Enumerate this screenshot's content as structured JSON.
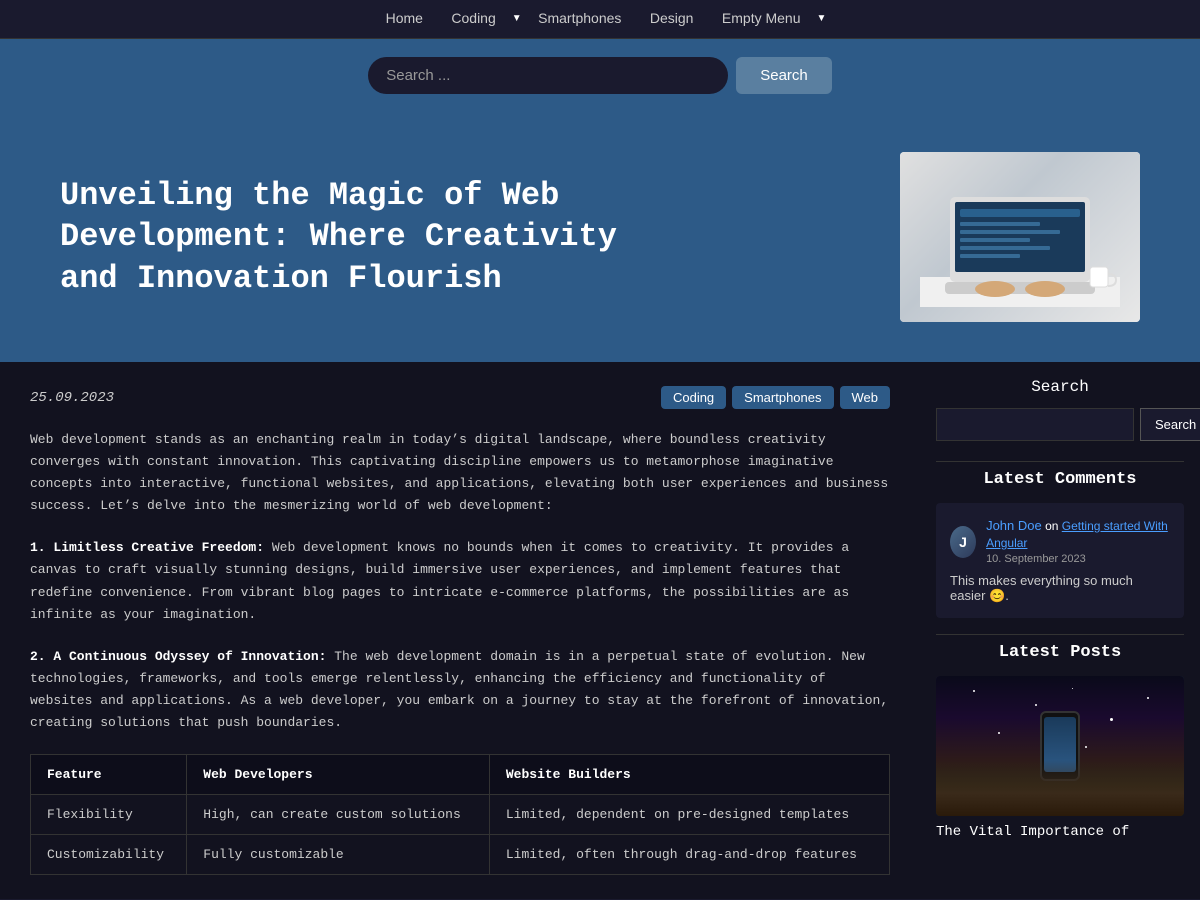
{
  "nav": {
    "items": [
      {
        "label": "Home",
        "href": "#",
        "dropdown": false
      },
      {
        "label": "Coding",
        "href": "#",
        "dropdown": true
      },
      {
        "label": "Smartphones",
        "href": "#",
        "dropdown": false
      },
      {
        "label": "Design",
        "href": "#",
        "dropdown": false
      },
      {
        "label": "Empty Menu",
        "href": "#",
        "dropdown": true
      }
    ]
  },
  "search_bar": {
    "placeholder": "Search ...",
    "button_label": "Search"
  },
  "hero": {
    "title": "Unveiling the Magic of Web Development: Where Creativity and Innovation Flourish"
  },
  "post": {
    "date": "25.09.2023",
    "tags": [
      "Coding",
      "Smartphones",
      "Web"
    ],
    "content_intro": "Web development stands as an enchanting realm in today’s digital landscape, where boundless creativity converges with constant innovation. This captivating discipline empowers us to metamorphose imaginative concepts into interactive, functional websites, and applications, elevating both user experiences and business success. Let’s delve into the mesmerizing world of web development:",
    "section1_title": "1. Limitless Creative Freedom:",
    "section1_text": " Web development knows no bounds when it comes to creativity. It provides a canvas to craft visually stunning designs, build immersive user experiences, and implement features that redefine convenience. From vibrant blog pages to intricate e-commerce platforms, the possibilities are as infinite as your imagination.",
    "section2_title": "2. A Continuous Odyssey of Innovation:",
    "section2_text": " The web development domain is in a perpetual state of evolution. New technologies, frameworks, and tools emerge relentlessly, enhancing the efficiency and functionality of websites and applications. As a web developer, you embark on a journey to stay at the forefront of innovation, creating solutions that push boundaries."
  },
  "table": {
    "headers": [
      "Feature",
      "Web Developers",
      "Website Builders"
    ],
    "rows": [
      [
        "Flexibility",
        "High, can create custom solutions",
        "Limited, dependent on pre-designed templates"
      ],
      [
        "Customizability",
        "Fully customizable",
        "Limited, often through drag-and-drop features"
      ]
    ]
  },
  "sidebar": {
    "search_title": "Search",
    "search_placeholder": "",
    "search_button": "Search",
    "latest_comments_title": "Latest Comments",
    "comment": {
      "author": "John Doe",
      "on_text": "on",
      "article_link": "Getting started With Angular",
      "date": "10. September 2023",
      "text": "This makes everything so much easier 😊."
    },
    "latest_posts_title": "Latest Posts",
    "latest_post_title": "The Vital Importance of"
  },
  "colors": {
    "nav_bg": "#1a1a2e",
    "hero_bg": "#2d5a87",
    "content_bg": "#12121f",
    "sidebar_bg": "#12121f",
    "tag_bg": "#2d5a87",
    "accent": "#4a9eff"
  }
}
